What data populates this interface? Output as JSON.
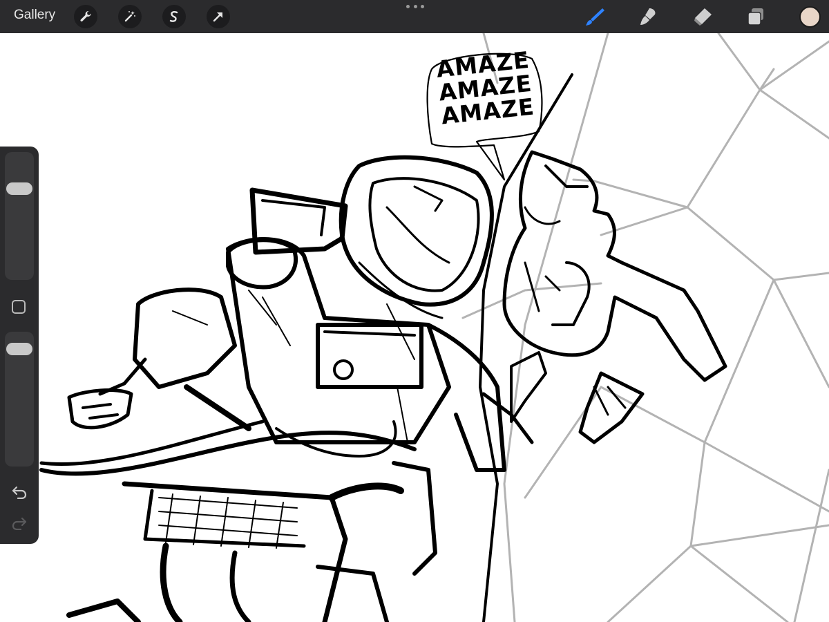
{
  "toolbar": {
    "gallery_label": "Gallery",
    "left_tools": [
      "actions-wrench-icon",
      "adjustments-magic-wand-icon",
      "selection-s-icon",
      "transform-arrow-icon"
    ],
    "right_tools": [
      "brush-icon",
      "smudge-icon",
      "eraser-icon",
      "layers-icon"
    ],
    "active_tool": "brush-icon",
    "active_tool_color": "#2e82ff",
    "current_color": "#e8d6c8"
  },
  "canvas": {
    "speech_bubble_lines": [
      "AMAZE",
      "AMAZE",
      "AMAZE"
    ]
  },
  "sidebar": {
    "brush_size_slider_level": 0.25,
    "opacity_slider_level": 0.07,
    "modify_button": "square-icon",
    "undo": "undo-icon",
    "redo": "redo-icon"
  }
}
